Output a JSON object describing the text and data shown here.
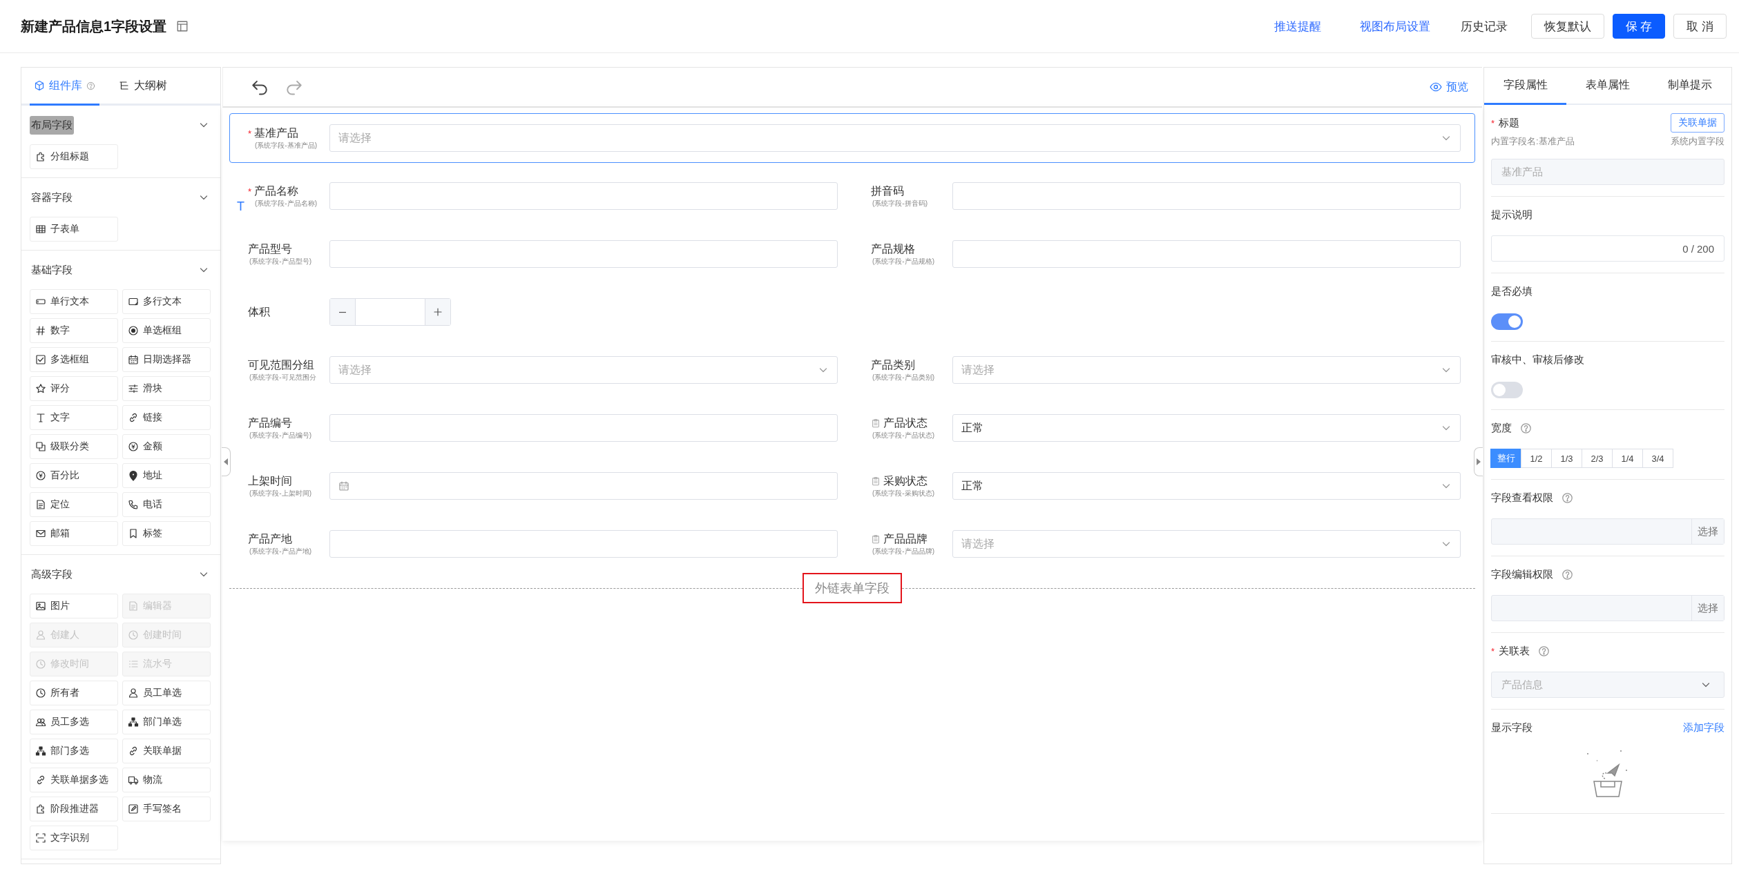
{
  "header": {
    "title": "新建产品信息1字段设置",
    "actions": [
      {
        "label": "推送提醒",
        "kind": "link"
      },
      {
        "label": "视图布局设置",
        "kind": "link"
      },
      {
        "label": "历史记录",
        "kind": "text"
      },
      {
        "label": "恢复默认",
        "kind": "default"
      },
      {
        "label": "保 存",
        "kind": "primary"
      },
      {
        "label": "取 消",
        "kind": "default"
      }
    ]
  },
  "library": {
    "tabs": [
      {
        "label": "组件库",
        "selected": true,
        "help": true
      },
      {
        "label": "大纲树",
        "selected": false,
        "help": false
      }
    ],
    "sections": [
      {
        "title": "布局字段",
        "tooltip": true,
        "items": [
          {
            "label": "分组标题",
            "disabled": false
          }
        ]
      },
      {
        "title": "容器字段",
        "tooltip": false,
        "items": [
          {
            "label": "子表单",
            "disabled": false
          }
        ]
      },
      {
        "title": "基础字段",
        "tooltip": false,
        "items": [
          {
            "label": "单行文本",
            "disabled": false
          },
          {
            "label": "多行文本",
            "disabled": false
          },
          {
            "label": "数字",
            "disabled": false
          },
          {
            "label": "单选框组",
            "disabled": false
          },
          {
            "label": "多选框组",
            "disabled": false
          },
          {
            "label": "日期选择器",
            "disabled": false
          },
          {
            "label": "评分",
            "disabled": false
          },
          {
            "label": "滑块",
            "disabled": false
          },
          {
            "label": "文字",
            "disabled": false
          },
          {
            "label": "链接",
            "disabled": false
          },
          {
            "label": "级联分类",
            "disabled": false
          },
          {
            "label": "金额",
            "disabled": false
          },
          {
            "label": "百分比",
            "disabled": false
          },
          {
            "label": "地址",
            "disabled": false
          },
          {
            "label": "定位",
            "disabled": false
          },
          {
            "label": "电话",
            "disabled": false
          },
          {
            "label": "邮箱",
            "disabled": false
          },
          {
            "label": "标签",
            "disabled": false
          }
        ]
      },
      {
        "title": "高级字段",
        "tooltip": false,
        "items": [
          {
            "label": "图片",
            "disabled": false
          },
          {
            "label": "编辑器",
            "disabled": true
          },
          {
            "label": "创建人",
            "disabled": true
          },
          {
            "label": "创建时间",
            "disabled": true
          },
          {
            "label": "修改时间",
            "disabled": true
          },
          {
            "label": "流水号",
            "disabled": true
          },
          {
            "label": "所有者",
            "disabled": false
          },
          {
            "label": "员工单选",
            "disabled": false
          },
          {
            "label": "员工多选",
            "disabled": false
          },
          {
            "label": "部门单选",
            "disabled": false
          },
          {
            "label": "部门多选",
            "disabled": false
          },
          {
            "label": "关联单据",
            "disabled": false
          },
          {
            "label": "关联单据多选",
            "disabled": false
          },
          {
            "label": "物流",
            "disabled": false
          },
          {
            "label": "阶段推进器",
            "disabled": false
          },
          {
            "label": "手写签名",
            "disabled": false
          },
          {
            "label": "文字识别",
            "disabled": false
          }
        ]
      }
    ]
  },
  "canvas": {
    "preview": "预览",
    "rows": [
      [
        {
          "label": "基准产品",
          "mark": "*",
          "hint": "(系统字段-基准产品)",
          "kind": "select",
          "locked": false,
          "selected": true,
          "placeholder": "请选择"
        }
      ],
      [
        {
          "label": "产品名称",
          "mark": "*",
          "hint": "(系统字段-产品名称)",
          "kind": "input",
          "locked": false,
          "selected": false,
          "marker": "T"
        },
        {
          "label": "拼音码",
          "hint": "(系统字段-拼音码)",
          "kind": "input",
          "locked": false,
          "selected": false
        }
      ],
      [
        {
          "label": "产品型号",
          "hint": "(系统字段-产品型号)",
          "kind": "input",
          "locked": false,
          "selected": false
        },
        {
          "label": "产品规格",
          "hint": "(系统字段-产品规格)",
          "kind": "input",
          "locked": false,
          "selected": false
        }
      ],
      [
        {
          "label": "体积",
          "kind": "number",
          "locked": false,
          "selected": false
        }
      ],
      [
        {
          "label": "可见范围分组",
          "hint": "(系统字段-可见范围分",
          "kind": "select",
          "locked": false,
          "selected": false,
          "placeholder": "请选择"
        },
        {
          "label": "产品类别",
          "hint": "(系统字段-产品类别)",
          "kind": "select",
          "locked": false,
          "selected": false,
          "placeholder": "请选择"
        }
      ],
      [
        {
          "label": "产品编号",
          "hint": "(系统字段-产品编号)",
          "kind": "input",
          "locked": false,
          "selected": false
        },
        {
          "label": "产品状态",
          "hint": "(系统字段-产品状态)",
          "kind": "select",
          "locked": true,
          "selected": false,
          "value": "正常"
        }
      ],
      [
        {
          "label": "上架时间",
          "hint": "(系统字段-上架时间)",
          "kind": "date",
          "locked": false,
          "selected": false
        },
        {
          "label": "采购状态",
          "hint": "(系统字段-采购状态)",
          "kind": "select",
          "locked": true,
          "selected": false,
          "value": "正常"
        }
      ],
      [
        {
          "label": "产品产地",
          "hint": "(系统字段-产品产地)",
          "kind": "input",
          "locked": false,
          "selected": false
        },
        {
          "label": "产品品牌",
          "hint": "(系统字段-产品品牌)",
          "kind": "select",
          "locked": true,
          "selected": false,
          "placeholder": "请选择"
        }
      ]
    ],
    "external": {
      "label": "外链表单字段",
      "highlighted": true
    }
  },
  "properties": {
    "tabs": [
      {
        "label": "字段属性",
        "selected": true
      },
      {
        "label": "表单属性",
        "selected": false
      },
      {
        "label": "制单提示",
        "selected": false
      }
    ],
    "items": [
      {
        "kind": "title",
        "label": "标题",
        "mark": "*",
        "help": false,
        "button": "关联单据",
        "note": "内置字段名:基准产品",
        "note_right": "系统内置字段",
        "value": "基准产品",
        "disabled": true
      },
      {
        "kind": "textarea",
        "label": "提示说明",
        "help": false,
        "counter": "0 / 200"
      },
      {
        "kind": "switch",
        "label": "是否必填",
        "help": false,
        "on": true
      },
      {
        "kind": "switch",
        "label": "审核中、审核后修改",
        "help": false,
        "on": false
      },
      {
        "kind": "segments",
        "label": "宽度",
        "help": true,
        "options": [
          {
            "label": "整行",
            "selected": true
          },
          {
            "label": "1/2",
            "selected": false
          },
          {
            "label": "1/3",
            "selected": false
          },
          {
            "label": "2/3",
            "selected": false
          },
          {
            "label": "1/4",
            "selected": false
          },
          {
            "label": "3/4",
            "selected": false
          }
        ]
      },
      {
        "kind": "picker",
        "label": "字段查看权限",
        "help": true,
        "button": "选择"
      },
      {
        "kind": "picker",
        "label": "字段编辑权限",
        "help": true,
        "button": "选择"
      },
      {
        "kind": "select",
        "label": "关联表",
        "mark": "*",
        "help": true,
        "value": "产品信息",
        "disabled": true
      },
      {
        "kind": "list",
        "label": "显示字段",
        "help": false,
        "link": "添加字段"
      }
    ]
  }
}
